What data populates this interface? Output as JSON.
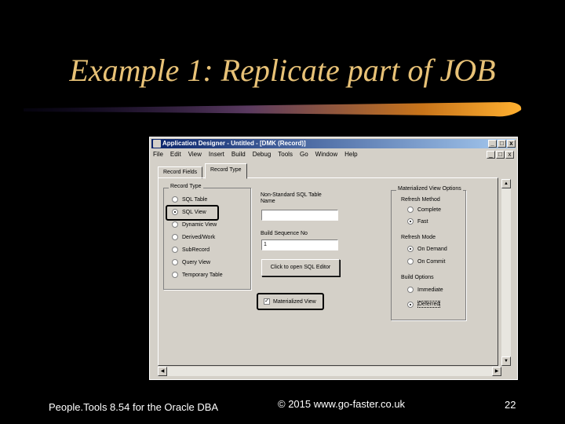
{
  "slide": {
    "title": "Example 1: Replicate part of JOB",
    "footer_left": "People.Tools 8.54 for the Oracle DBA",
    "footer_center": "© 2015 www.go-faster.co.uk",
    "page_number": "22"
  },
  "window": {
    "title": "Application Designer - Untitled - [DMK (Record)]",
    "controls": [
      "_",
      "□",
      "x"
    ],
    "menu": [
      "File",
      "Edit",
      "View",
      "Insert",
      "Build",
      "Debug",
      "Tools",
      "Go",
      "Window",
      "Help"
    ],
    "tabs": [
      "Record Fields",
      "Record Type"
    ],
    "active_tab": "Record Type"
  },
  "record_type": {
    "label": "Record Type",
    "options": [
      "SQL Table",
      "SQL View",
      "Dynamic View",
      "Derived/Work",
      "SubRecord",
      "Query View",
      "Temporary Table"
    ],
    "selected": "SQL View"
  },
  "sql_table_name": {
    "label": "Non-Standard SQL Table Name",
    "value": ""
  },
  "build_sequence": {
    "label": "Build Sequence No",
    "value": "1"
  },
  "sql_editor_button": "Click to open SQL Editor",
  "materialized_view": {
    "label": "Materialized View",
    "checked": true,
    "check_mark": "✓"
  },
  "mv_options": {
    "label": "Materialized View Options",
    "refresh_method": {
      "label": "Refresh Method",
      "options": [
        "Complete",
        "Fast"
      ],
      "selected": "Fast"
    },
    "refresh_mode": {
      "label": "Refresh Mode",
      "options": [
        "On Demand",
        "On Commit"
      ],
      "selected": "On Demand"
    },
    "build_options": {
      "label": "Build Options",
      "options": [
        "Immediate",
        "Deferred"
      ],
      "selected": "Deferred"
    }
  },
  "colors": {
    "title": "#e8c277",
    "background": "#000000",
    "window_face": "#d4d0c8",
    "titlebar": "#0a246a"
  }
}
